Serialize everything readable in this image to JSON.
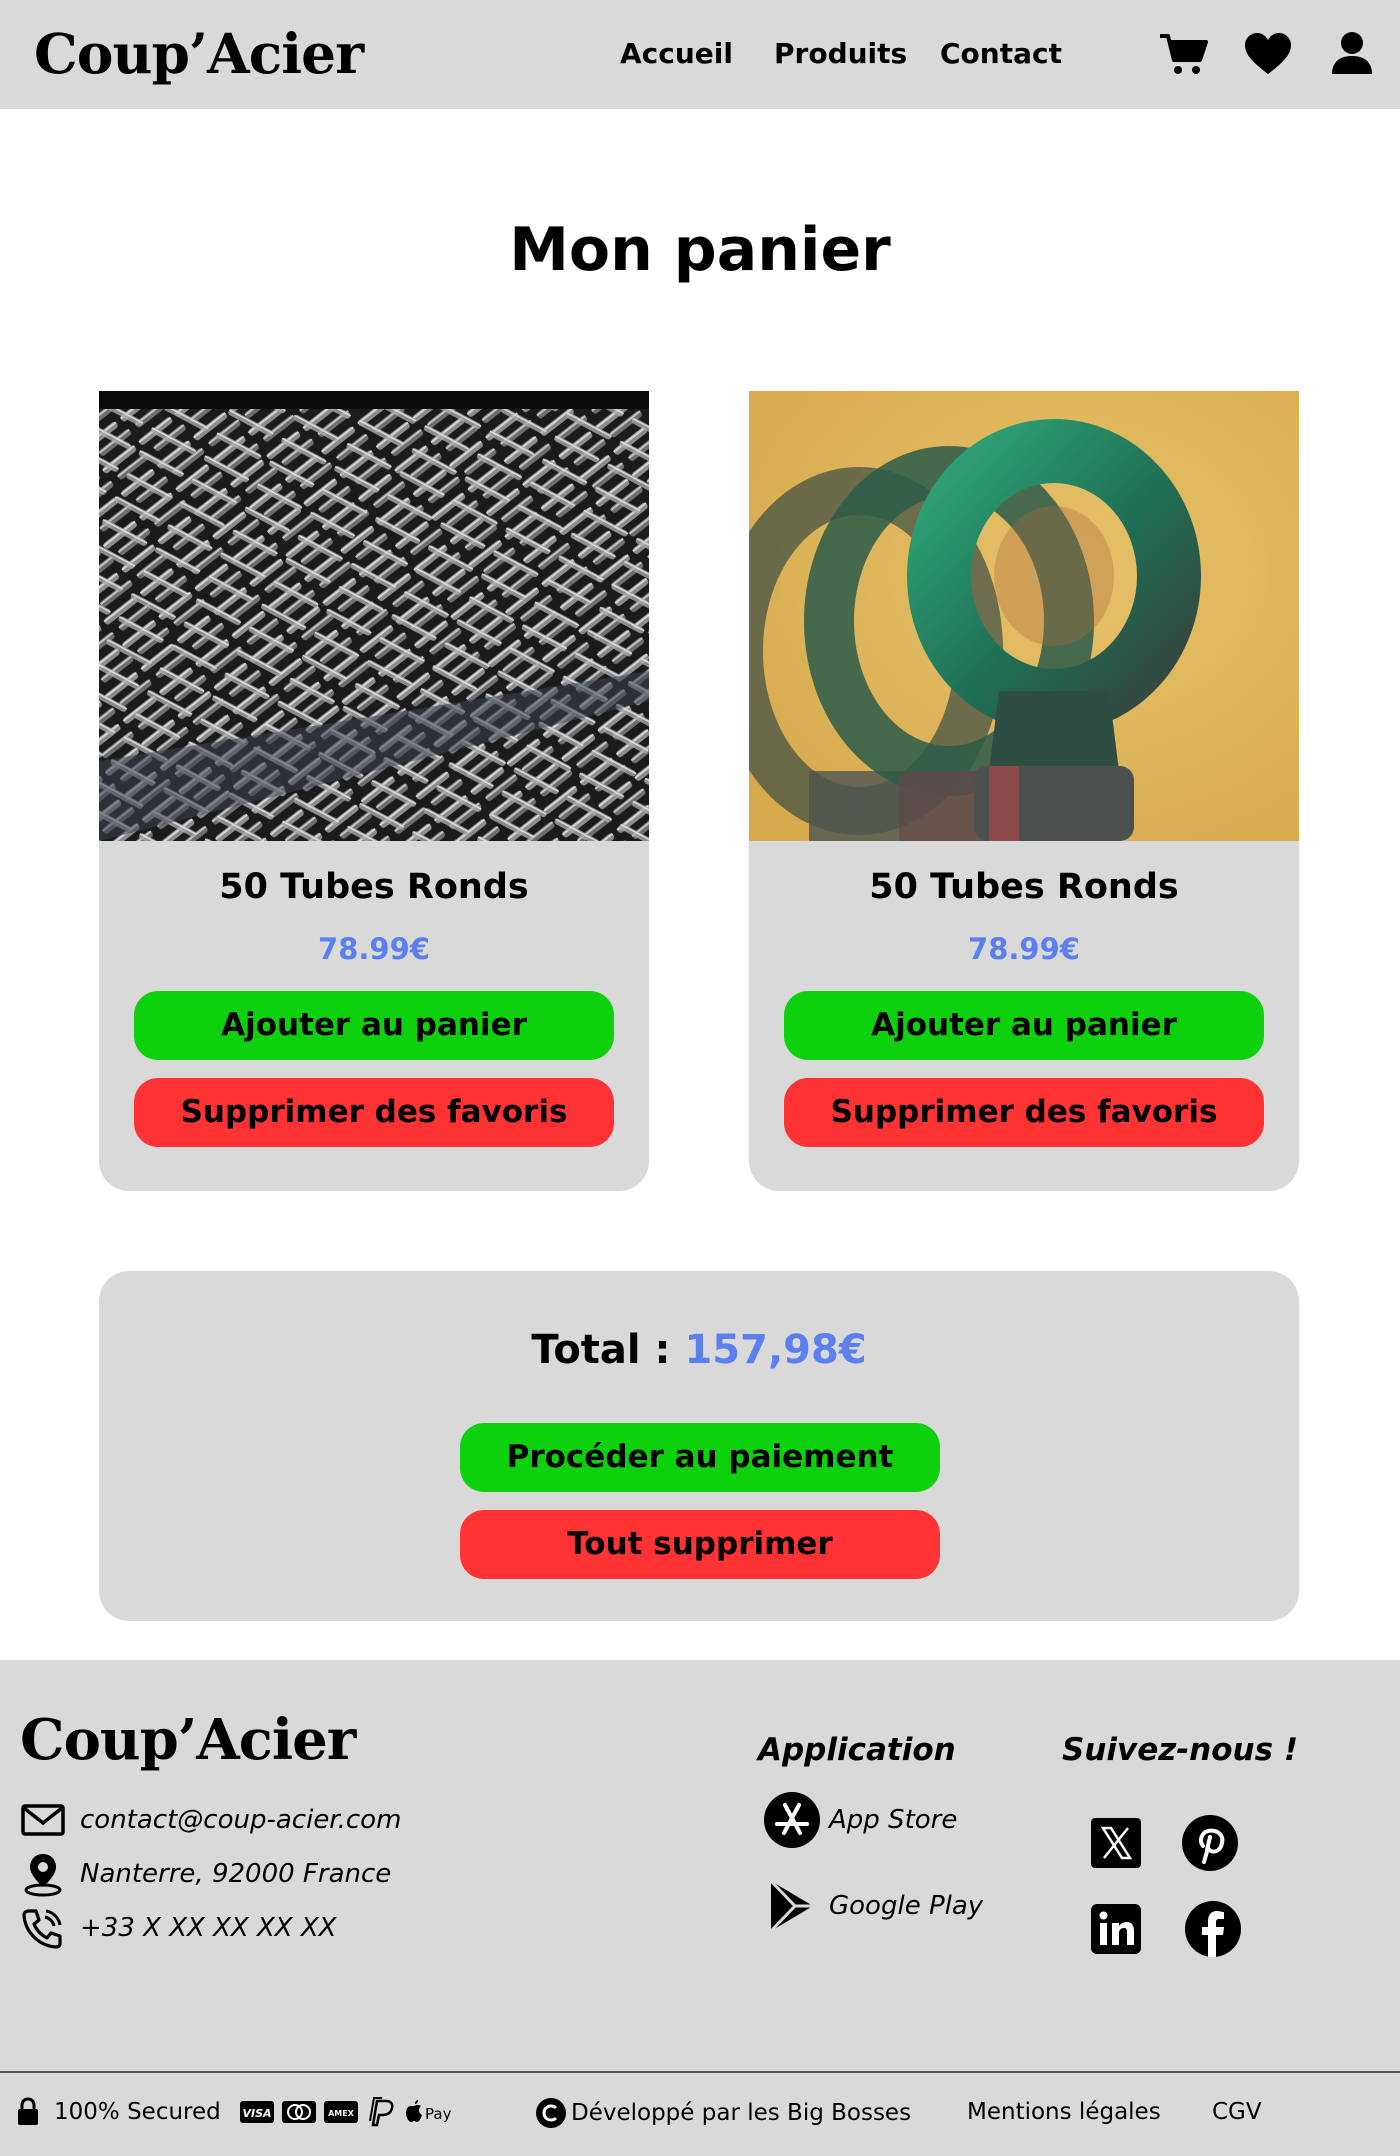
{
  "brand": {
    "name": "Coup’Acier"
  },
  "nav": {
    "items": [
      {
        "label": "Accueil"
      },
      {
        "label": "Produits"
      },
      {
        "label": "Contact"
      }
    ],
    "icons": [
      "cart-icon",
      "heart-icon",
      "user-icon"
    ]
  },
  "page": {
    "title": "Mon panier"
  },
  "cart": {
    "items": [
      {
        "name": "50 Tubes Ronds",
        "price": "78.99€",
        "add_label": "Ajouter au panier",
        "remove_label": "Supprimer des favoris"
      },
      {
        "name": "50 Tubes Ronds",
        "price": "78.99€",
        "add_label": "Ajouter au panier",
        "remove_label": "Supprimer des favoris"
      }
    ],
    "total_label": "Total : ",
    "total_value": "157,98€",
    "pay_label": "Procéder au paiement",
    "clear_label": "Tout supprimer"
  },
  "footer": {
    "brand": "Coup’Acier",
    "email": "contact@coup-acier.com",
    "location": "Nanterre, 92000 France",
    "phone": "+33 X XX XX XX XX",
    "app_heading": "Application",
    "app_store": "App Store",
    "google_play": "Google Play",
    "social_heading": "Suivez-nous !",
    "social_icons": [
      "x-icon",
      "pinterest-icon",
      "linkedin-icon",
      "facebook-icon"
    ],
    "secured": "100% Secured",
    "payment_icons": [
      "visa-icon",
      "mastercard-icon",
      "amex-icon",
      "paypal-icon",
      "apple-pay-icon"
    ],
    "developed_by": "Développé par les Big Bosses",
    "legal": "Mentions légales",
    "cgv": "CGV"
  },
  "colors": {
    "header_bg": "#d9d9d9",
    "title_highlight": "#ffee00",
    "price": "#5b7ff0",
    "green_button": "#0ed10e",
    "red_button": "#ff3333"
  }
}
